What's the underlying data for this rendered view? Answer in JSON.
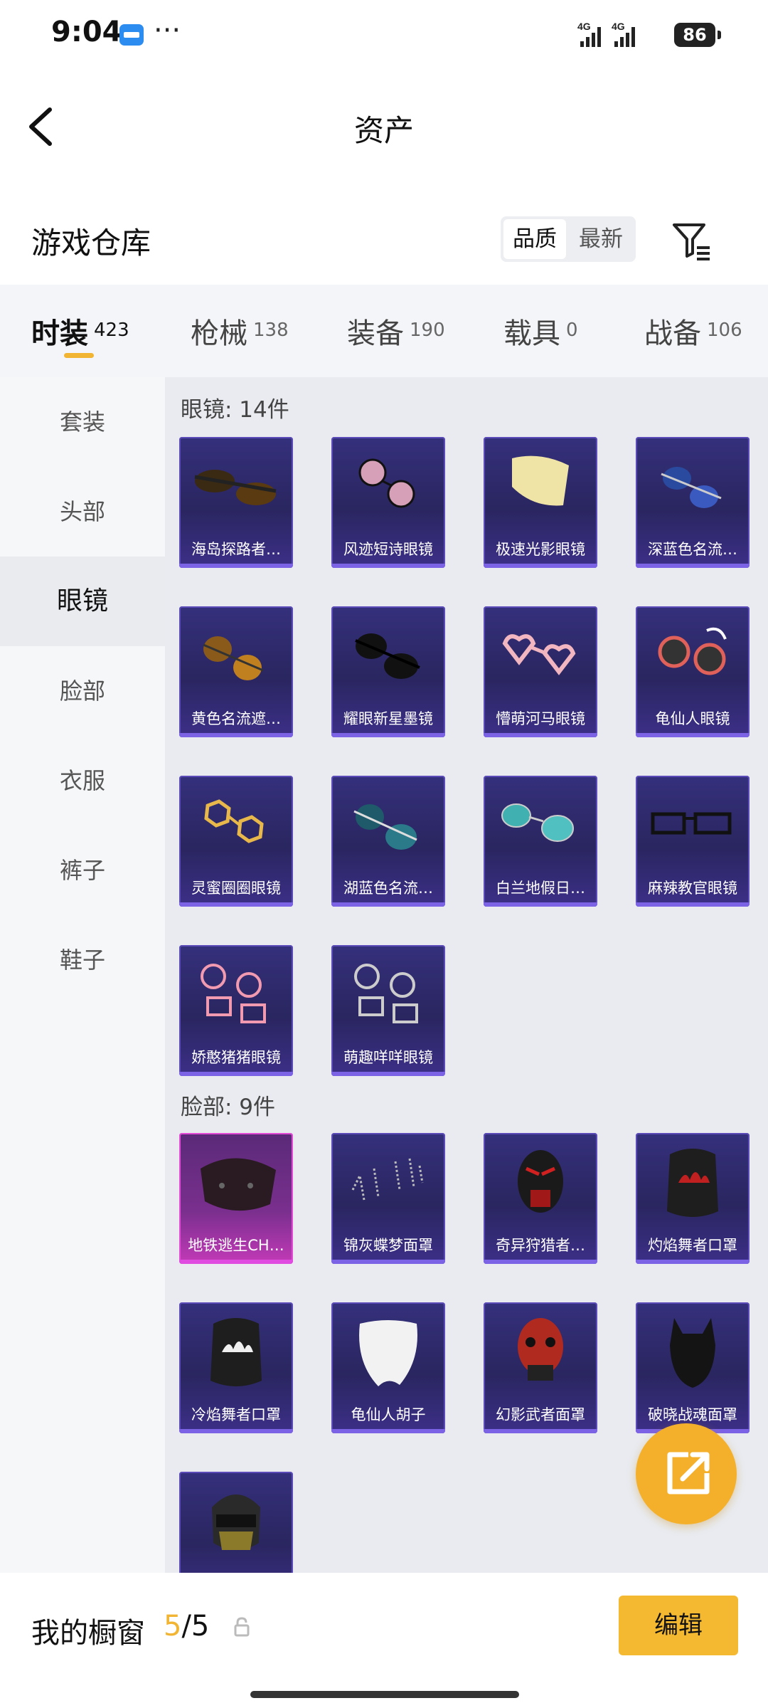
{
  "status_bar": {
    "time": "9:04",
    "network": "4G",
    "network2": "4G",
    "battery": "86"
  },
  "header": {
    "title": "资产"
  },
  "warehouse": {
    "title": "游戏仓库",
    "sort_quality": "品质",
    "sort_newest": "最新"
  },
  "tabs": [
    {
      "label": "时装",
      "count": "423"
    },
    {
      "label": "枪械",
      "count": "138"
    },
    {
      "label": "装备",
      "count": "190"
    },
    {
      "label": "载具",
      "count": "0"
    },
    {
      "label": "战备",
      "count": "106"
    }
  ],
  "sidebar": {
    "items": [
      "套装",
      "头部",
      "眼镜",
      "脸部",
      "衣服",
      "裤子",
      "鞋子"
    ],
    "active": "眼镜"
  },
  "sections": [
    {
      "title": "眼镜: 14件",
      "items": [
        "海岛探路者…",
        "风迹短诗眼镜",
        "极速光影眼镜",
        "深蓝色名流…",
        "黄色名流遮…",
        "耀眼新星墨镜",
        "懵萌河马眼镜",
        "龟仙人眼镜",
        "灵蜜圈圈眼镜",
        "湖蓝色名流…",
        "白兰地假日…",
        "麻辣教官眼镜",
        "娇憨猪猪眼镜",
        "萌趣咩咩眼镜"
      ]
    },
    {
      "title": "脸部: 9件",
      "items": [
        "地铁逃生CH…",
        "锦灰蝶梦面罩",
        "奇异狩猎者…",
        "灼焰舞者口罩",
        "冷焰舞者口罩",
        "龟仙人胡子",
        "幻影武者面罩",
        "破晓战魂面罩",
        ""
      ]
    }
  ],
  "bottom": {
    "showcase_label": "我的橱窗",
    "showcase_current": "5",
    "showcase_total": "/5",
    "edit_label": "编辑"
  },
  "colors": {
    "accent": "#f2b533",
    "card_purple": "#2a2660",
    "card_pink": "#c33ab8"
  }
}
